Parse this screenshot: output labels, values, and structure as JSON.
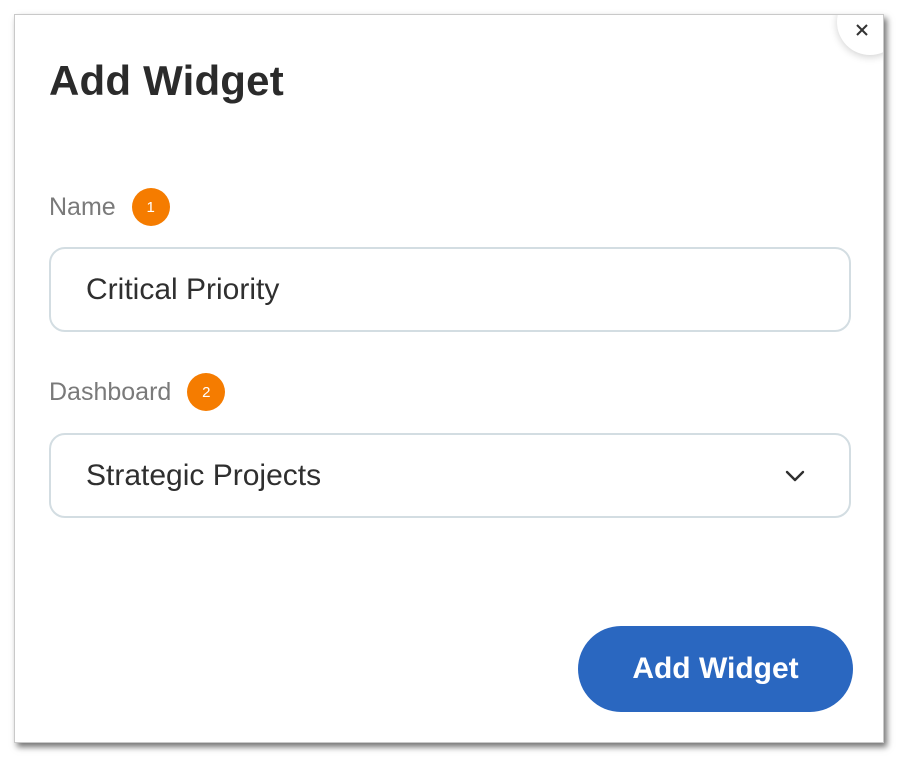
{
  "dialog": {
    "title": "Add Widget"
  },
  "form": {
    "name": {
      "label": "Name",
      "step": "1",
      "value": "Critical Priority"
    },
    "dashboard": {
      "label": "Dashboard",
      "step": "2",
      "selected": "Strategic Projects"
    }
  },
  "actions": {
    "submit_label": "Add Widget"
  },
  "icons": {
    "close": "close-icon",
    "dropdown": "chevron-down-icon"
  },
  "colors": {
    "accent": "#2a67c0",
    "step_badge": "#f57c00",
    "title_text": "#2b2b2b",
    "label_text": "#7a7a7a",
    "input_border": "#d3dde2"
  }
}
